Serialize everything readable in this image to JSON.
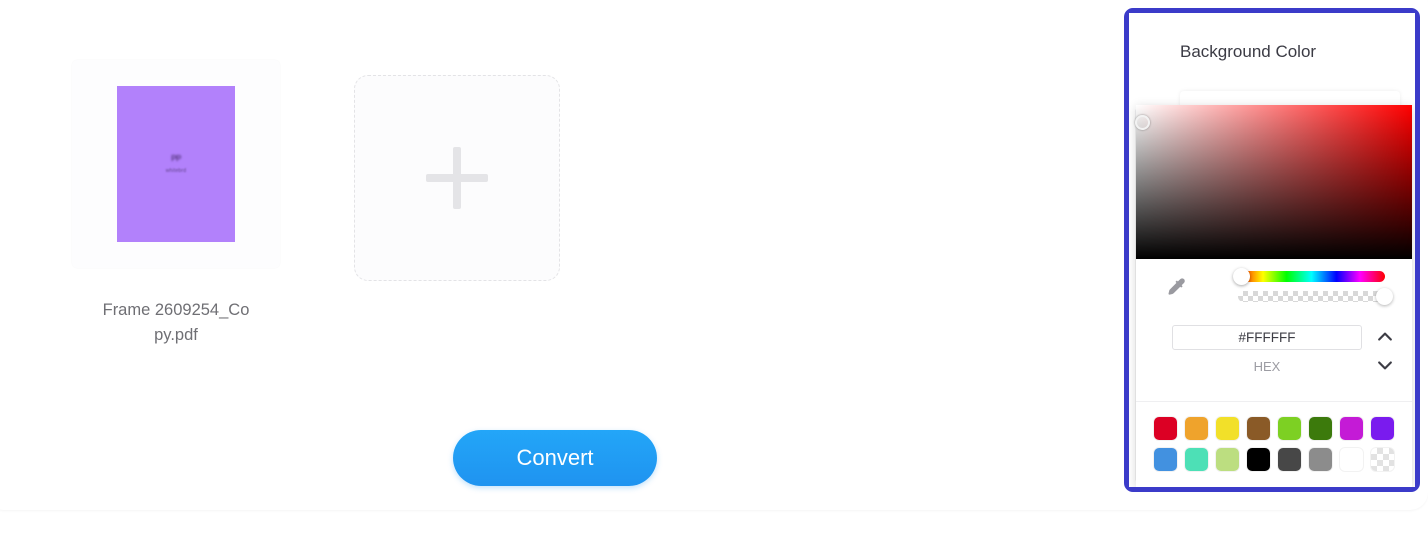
{
  "files": {
    "items": [
      {
        "name": "Frame 2609254_Copy.pdf",
        "thumb_line_1": "PP",
        "thumb_line_2": "whitebrd",
        "thumb_color": "#B281FB"
      }
    ],
    "add_label": "+"
  },
  "actions": {
    "convert_label": "Convert"
  },
  "panel": {
    "title": "Background Color",
    "select_value": "",
    "picker": {
      "hex_value": "#FFFFFF",
      "hex_label": "HEX",
      "eyedropper_name": "eyedropper-icon",
      "stepper_up": "⌃",
      "stepper_down": "⌄",
      "swatches_row_1": [
        "#DC0024",
        "#EFA32C",
        "#F2E029",
        "#8A5A27",
        "#7DD023",
        "#3C7A0C",
        "#C41BD6",
        "#7A1BEE"
      ],
      "swatches_row_2": [
        "#4291E0",
        "#4DE0B6",
        "#BCDE80",
        "#000000",
        "#474747",
        "#8C8C8C",
        "#FFFFFF",
        "transparent"
      ]
    }
  },
  "colors": {
    "accent_blue": "#1F93F0",
    "highlight_border": "#3B3BC9",
    "panel_title": "#3B3B44"
  }
}
